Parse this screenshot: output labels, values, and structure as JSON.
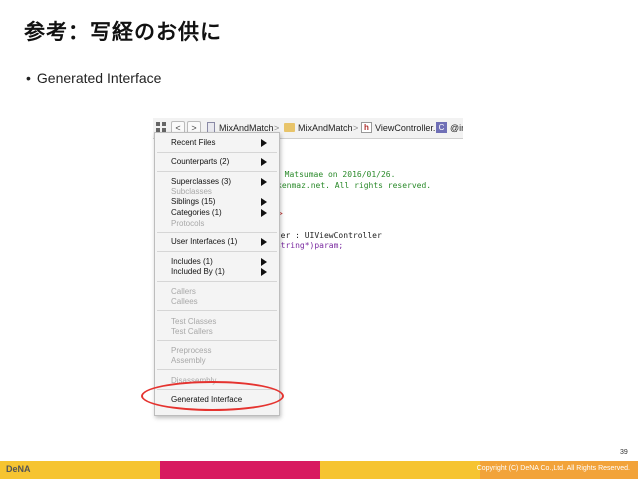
{
  "slide": {
    "title": "参考：写経のお供に",
    "bullet": "Generated Interface",
    "page_number": "39"
  },
  "jumpbar": {
    "project": "MixAndMatch",
    "folder": "MixAndMatch",
    "file": "ViewController.h",
    "symbol": "@in",
    "back_glyph": "<",
    "forward_glyph": ">",
    "separator": ">",
    "h_glyph": "h",
    "c_glyph": "C"
  },
  "code_lines": {
    "line1": "y Matsumae on 2016/01/26.",
    "line2": "kenmaz.net. All rights reserved.",
    "line3": "h>",
    "line4": "ller : UIViewController",
    "line5": "SString*)param;"
  },
  "menu": {
    "recent_files": "Recent Files",
    "counterparts": "Counterparts (2)",
    "superclasses": "Superclasses (3)",
    "subclasses": "Subclasses",
    "siblings": "Siblings (15)",
    "categories": "Categories (1)",
    "protocols": "Protocols",
    "user_interfaces": "User Interfaces (1)",
    "includes": "Includes (1)",
    "included_by": "Included By (1)",
    "callers": "Callers",
    "callees": "Callees",
    "test_classes": "Test Classes",
    "test_callers": "Test Callers",
    "preprocess": "Preprocess",
    "assembly": "Assembly",
    "disassembly": "Disassembly",
    "generated_interface": "Generated Interface"
  },
  "footer": {
    "logo": "DeNA",
    "copyright": "Copyright (C) DeNA Co.,Ltd. All Rights Reserved."
  },
  "colors": {
    "highlight": "#e5332f",
    "footer_yellow": "#f6c431",
    "footer_magenta": "#d81b60",
    "footer_orange": "#f2a33a"
  }
}
